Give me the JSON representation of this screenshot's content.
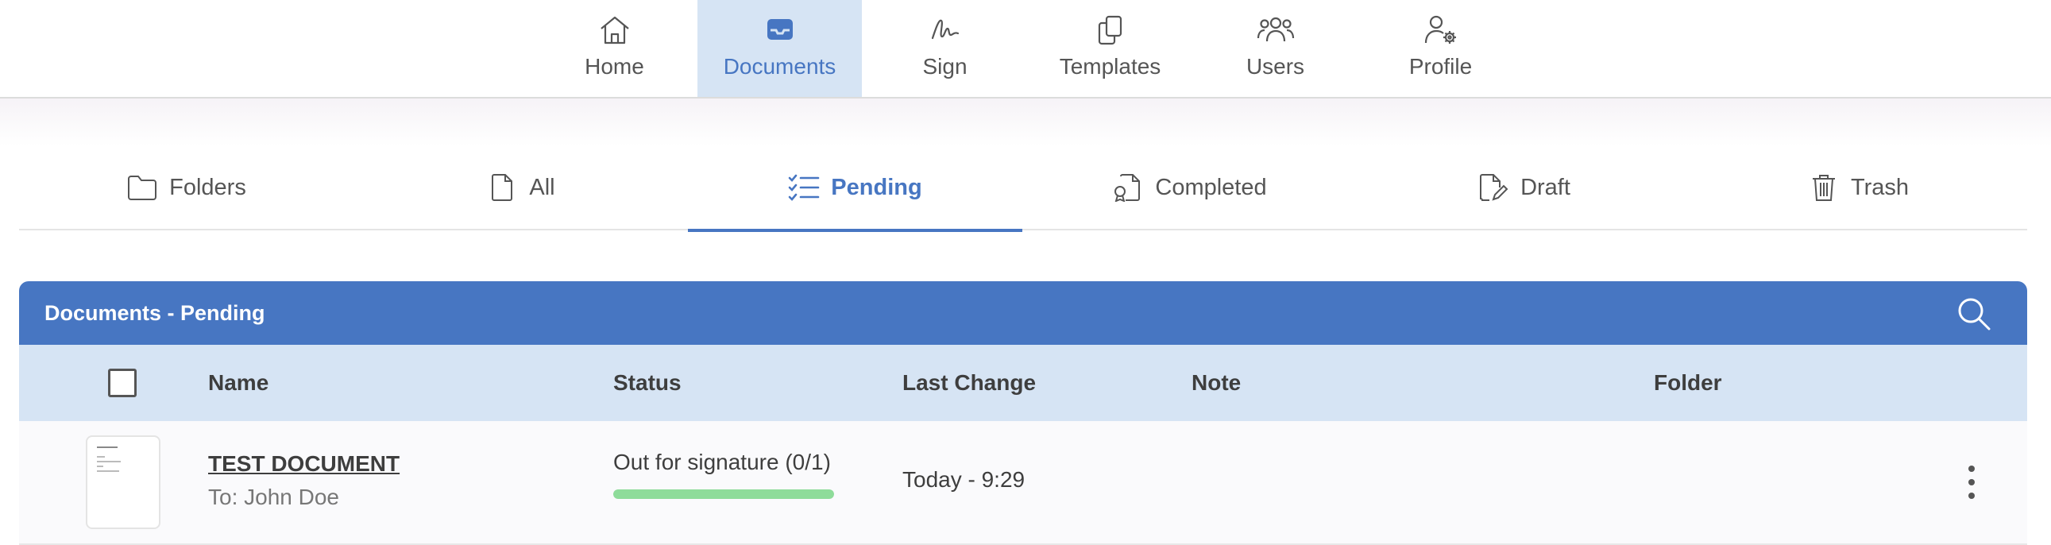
{
  "topnav": {
    "items": [
      {
        "label": "Home",
        "icon": "home-icon"
      },
      {
        "label": "Documents",
        "icon": "inbox-icon",
        "active": true
      },
      {
        "label": "Sign",
        "icon": "signature-icon"
      },
      {
        "label": "Templates",
        "icon": "copy-icon"
      },
      {
        "label": "Users",
        "icon": "users-icon"
      },
      {
        "label": "Profile",
        "icon": "user-gear-icon"
      }
    ]
  },
  "subtabs": {
    "items": [
      {
        "label": "Folders",
        "icon": "folder-icon"
      },
      {
        "label": "All",
        "icon": "file-icon"
      },
      {
        "label": "Pending",
        "icon": "checklist-icon",
        "active": true
      },
      {
        "label": "Completed",
        "icon": "file-badge-icon"
      },
      {
        "label": "Draft",
        "icon": "file-pen-icon"
      },
      {
        "label": "Trash",
        "icon": "trash-icon"
      }
    ]
  },
  "panel": {
    "title": "Documents - Pending",
    "columns": {
      "name": "Name",
      "status": "Status",
      "last_change": "Last Change",
      "note": "Note",
      "folder": "Folder"
    },
    "rows": [
      {
        "name": "TEST DOCUMENT",
        "recipient": "To: John Doe",
        "status": "Out for signature (0/1)",
        "progress": 1.0,
        "last_change": "Today - 9:29",
        "note": "",
        "folder": ""
      }
    ]
  },
  "colors": {
    "accent": "#4776c2",
    "active_bg": "#d6e4f4",
    "progress": "#8edc9a"
  }
}
